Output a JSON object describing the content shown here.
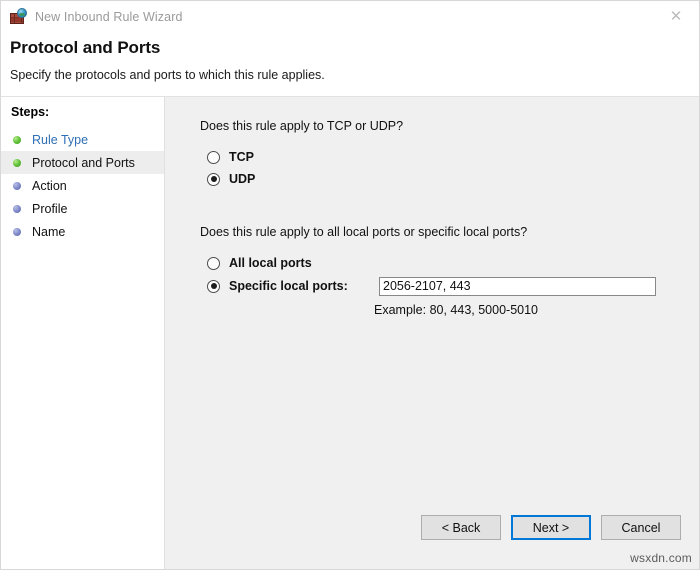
{
  "window": {
    "title": "New Inbound Rule Wizard",
    "icon": "firewall-globe-icon",
    "close_label": "✕"
  },
  "header": {
    "title": "Protocol and Ports",
    "subtitle": "Specify the protocols and ports to which this rule applies."
  },
  "sidebar": {
    "label": "Steps:",
    "items": [
      {
        "label": "Rule Type",
        "state": "done",
        "link": true
      },
      {
        "label": "Protocol and Ports",
        "state": "done",
        "link": false
      },
      {
        "label": "Action",
        "state": "todo",
        "link": false
      },
      {
        "label": "Profile",
        "state": "todo",
        "link": false
      },
      {
        "label": "Name",
        "state": "todo",
        "link": false
      }
    ],
    "current_index": 1
  },
  "main": {
    "protocol_question": "Does this rule apply to TCP or UDP?",
    "protocol_options": [
      {
        "label": "TCP",
        "selected": false
      },
      {
        "label": "UDP",
        "selected": true
      }
    ],
    "ports_question": "Does this rule apply to all local ports or specific local ports?",
    "all_ports_label": "All local ports",
    "all_ports_selected": false,
    "specific_ports_label": "Specific local ports:",
    "specific_ports_selected": true,
    "ports_value": "2056-2107, 443",
    "ports_placeholder": "",
    "example_text": "Example: 80, 443, 5000-5010"
  },
  "footer": {
    "back_label": "< Back",
    "next_label": "Next >",
    "cancel_label": "Cancel"
  },
  "watermark": "wsxdn.com",
  "colors": {
    "accent": "#0078d7",
    "link": "#2f6fb5",
    "panel": "#f0f0f0",
    "done_dot": "#5bbd34",
    "todo_dot": "#7b86c6"
  }
}
